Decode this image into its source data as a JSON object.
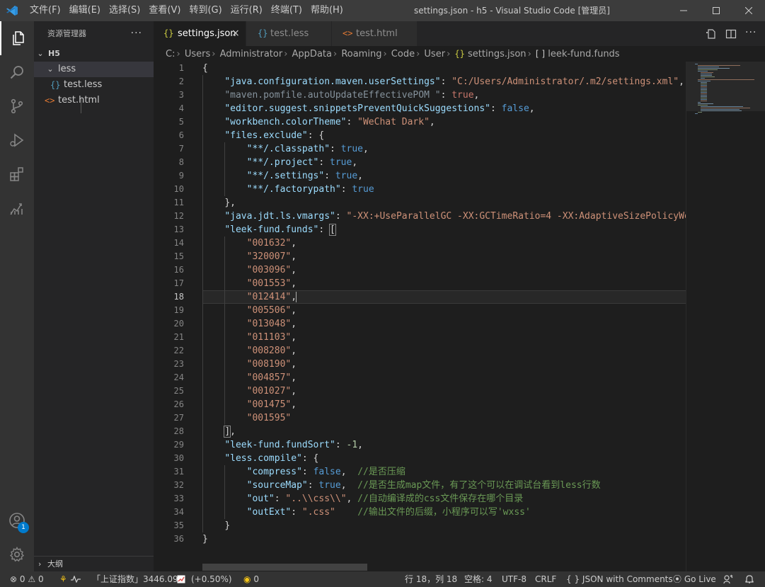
{
  "titlebar": {
    "menus": [
      "文件(F)",
      "编辑(E)",
      "选择(S)",
      "查看(V)",
      "转到(G)",
      "运行(R)",
      "终端(T)",
      "帮助(H)"
    ],
    "window_title": "settings.json - h5 - Visual Studio Code [管理员]"
  },
  "activity": {
    "accounts_badge": "1"
  },
  "sidebar": {
    "title": "资源管理器",
    "more": "···",
    "root": "H5",
    "folder": "less",
    "folder_file": "test.less",
    "file": "test.html",
    "outline": "大纲",
    "json_icon": "{}",
    "html_icon": "<>"
  },
  "tabs": [
    {
      "label": "settings.json",
      "icon": "{}",
      "active": true,
      "close": "×"
    },
    {
      "label": "test.less",
      "icon": "{}"
    },
    {
      "label": "test.html",
      "icon": "<>"
    }
  ],
  "breadcrumb": {
    "parts": [
      "C:",
      "Users",
      "Administrator",
      "AppData",
      "Roaming",
      "Code",
      "User"
    ],
    "file_icon": "{}",
    "file": "settings.json",
    "symbol_icon": "[ ]",
    "symbol": "leek-fund.funds",
    "sep": "›"
  },
  "editor": {
    "line_numbers": [
      "1",
      "2",
      "3",
      "4",
      "5",
      "6",
      "7",
      "8",
      "9",
      "10",
      "11",
      "12",
      "13",
      "14",
      "15",
      "16",
      "17",
      "18",
      "19",
      "20",
      "21",
      "22",
      "23",
      "24",
      "25",
      "26",
      "27",
      "28",
      "29",
      "30",
      "31",
      "32",
      "33",
      "34",
      "35",
      "36"
    ],
    "current_line": "18",
    "code": {
      "l1_open": "{",
      "l2_key": "\"java.configuration.maven.userSettings\"",
      "l2_val": "\"C:/Users/Administrator/.m2/settings.xml\"",
      "l3_key": "\"maven.pomfile.autoUpdateEffectivePOM \"",
      "l3_val": "true",
      "l4_key": "\"editor.suggest.snippetsPreventQuickSuggestions\"",
      "l4_val": "false",
      "l5_key": "\"workbench.colorTheme\"",
      "l5_val": "\"WeChat Dark\"",
      "l6_key": "\"files.exclude\"",
      "l6_val": "{",
      "l7_key": "\"**/.classpath\"",
      "l7_val": "true",
      "l8_key": "\"**/.project\"",
      "l8_val": "true",
      "l9_key": "\"**/.settings\"",
      "l9_val": "true",
      "l10_key": "\"**/.factorypath\"",
      "l10_val": "true",
      "l11_close": "},",
      "l12_key": "\"java.jdt.ls.vmargs\"",
      "l12_val": "\"-XX:+UseParallelGC -XX:GCTimeRatio=4 -XX:AdaptiveSizePolicyWei",
      "l13_key": "\"leek-fund.funds\"",
      "l13_val": "[",
      "funds": [
        "\"001632\"",
        "\"320007\"",
        "\"003096\"",
        "\"001553\"",
        "\"012414\"",
        "\"005506\"",
        "\"013048\"",
        "\"011103\"",
        "\"008280\"",
        "\"008190\"",
        "\"004857\"",
        "\"001027\"",
        "\"001475\"",
        "\"001595\""
      ],
      "l28_close": "]",
      "l29_key": "\"leek-fund.fundSort\"",
      "l29_val": "-1",
      "l30_key": "\"less.compile\"",
      "l30_val": "{",
      "l31_key": "\"compress\"",
      "l31_val": "false",
      "l31_cmt": "//是否压缩",
      "l32_key": "\"sourceMap\"",
      "l32_val": "true",
      "l32_cmt": "//是否生成map文件，有了这个可以在调试台看到less行数",
      "l33_key": "\"out\"",
      "l33_val": "\"..\\\\css\\\\\"",
      "l33_cmt": "//自动编译成的css文件保存在哪个目录",
      "l34_key": "\"outExt\"",
      "l34_val": "\".css\"",
      "l34_cmt": "//输出文件的后缀，小程序可以写'wxss'",
      "l35_close": "}",
      "l36_close": "}"
    }
  },
  "statusbar": {
    "errors": "0",
    "warnings": "0",
    "stock_name": "「上证指数」",
    "stock_value": "3446.09",
    "stock_change": "(+0.50%)",
    "fund_count": "0",
    "position": "行 18，列 18",
    "spaces": "空格: 4",
    "encoding": "UTF-8",
    "eol": "CRLF",
    "lang_icon": "{ }",
    "language": "JSON with Comments",
    "golive": "Go Live"
  },
  "colors": {
    "accent": "#007acc",
    "titlebar": "#3c3c3c",
    "activity": "#333333",
    "sidebar": "#252526",
    "editor": "#1e1e1e",
    "key": "#9cdcfe",
    "string": "#ce9178",
    "keyword": "#569cd6",
    "number": "#b5cea8",
    "comment": "#6a9955"
  }
}
